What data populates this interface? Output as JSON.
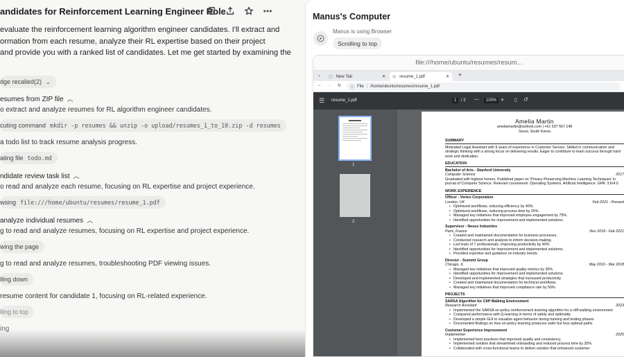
{
  "task": {
    "title": "andidates for Reinforcement Learning Engineer Role"
  },
  "chat": {
    "intro": [
      "evaluate the reinforcement learning algorithm engineer candidates. I'll extract and",
      "ormation from each resume, analyze their RL expertise based on their project",
      "and provide you with a ranked list of candidates. Let me get started by examining the"
    ],
    "knowledge_pill": "dge recalled(2)",
    "sections": [
      {
        "title": "esumes from ZIP file",
        "desc": "o extract and analyze resumes for RL algorithm engineer candidates."
      },
      {
        "title": "ndidate review task list",
        "desc": "o read and analyze each resume, focusing on RL expertise and project experience."
      },
      {
        "title": " analyze individual resumes",
        "desc": "g to read and analyze resumes, focusing on RL expertise and project experience."
      }
    ],
    "step1": {
      "label": "cuting command",
      "code": "mkdir -p resumes && unzip -o upload/resumes_1_to_10.zip -d resumes"
    },
    "step1_note": "a todo list to track resume analysis progress.",
    "step2": {
      "label": "ating file",
      "code": "todo.md"
    },
    "step3": {
      "label": "wsing",
      "code": "file:///home/ubuntu/resumes/resume_1.pdf"
    },
    "step4": "wing the page",
    "step4_note": "g to read and analyze resumes, troubleshooting PDF viewing issues.",
    "step5": "lling down",
    "step5_note": "resume content for candidate 1, focusing on RL-related experience.",
    "step6": "lling to top",
    "step7": "ing"
  },
  "computer": {
    "title": "Manus's Computer",
    "status_line": "Manus is using Browser",
    "status_chip": "Scrolling to top",
    "viewer_url": "file:///home/ubuntu/resumes/resum...",
    "tabs": [
      "New Tab",
      "resume_1.pdf"
    ],
    "address_label": "File",
    "address": "/home/ubuntu/resumes/resume_1.pdf",
    "pdf_name": "resume_1.pdf",
    "page_current": "1",
    "page_total": "/ 2",
    "zoom": "100%",
    "thumbs": [
      "1",
      "2"
    ]
  },
  "resume": {
    "name": "Amelia Martin",
    "contact": "ameliamartin@outlook.com | +61 537 567 148",
    "location": "Seoul, South Korea",
    "summary_h": "SUMMARY",
    "summary": "Motivated Legal Assistant with 9 years of experience in Customer Service. Skilled in communication and strategic thinking with a strong focus on delivering results. Eager to contribute to team success through hard work and dedication.",
    "education_h": "EDUCATION",
    "edu_degree": "Bachelor of Arts - Stanford University",
    "edu_field": "Computer Science",
    "edu_year": "2017",
    "edu_desc": "Graduated with highest honors. Published paper on 'Privacy-Preserving Machine Learning Techniques' in journal of Computer Science. Relevant coursework: Operating Systems, Artificial Intelligence. GPA: 3.6/4.0.",
    "work_h": "WORK EXPERIENCE",
    "jobs": [
      {
        "title": "Officer - Vertex Corporation",
        "loc": "London, UK",
        "dates": "Feb 2021 - Present",
        "bullets": [
          "Optimized workflows, reducing efficiency by 40%.",
          "Optimized workflows, reducing process time by 25%.",
          "Managed key initiatives that improved employee engagement by 75%.",
          "Identified opportunities for improvement and implemented solutions."
        ]
      },
      {
        "title": "Supervisor - Nexus Industries",
        "loc": "Paris, France",
        "dates": "Nov 2018 - Feb 2021",
        "bullets": [
          "Created and maintained documentation for business processes.",
          "Conducted research and analysis to inform decision-making.",
          "Led team of 7 professionals, improving productivity by 40%.",
          "Identified opportunities for improvement and implemented solutions.",
          "Provided expertise and guidance on industry trends."
        ]
      },
      {
        "title": "Director - Summit Group",
        "loc": "Chicago, IL",
        "dates": "May 2016 - Mar 2018",
        "bullets": [
          "Managed key initiatives that improved quality metrics by 30%.",
          "Identified opportunities for improvement and implemented solutions.",
          "Developed and implemented strategies that increased productivity.",
          "Created and maintained documentation for technical workflows.",
          "Managed key initiatives that improved compliance rate by 50%."
        ]
      }
    ],
    "projects_h": "PROJECTS",
    "projects": [
      {
        "title": "SARSA Algorithm for Cliff Walking Environment",
        "role": "Research Assistant",
        "year": "2023",
        "bullets": [
          "Implemented the SARSA on-policy reinforcement learning algorithm for a cliff walking environment",
          "Compared performance with Q-learning in terms of safety and optimality",
          "Developed a simple GUI to visualize agent behavior during training and testing phases",
          "Documented findings on how on-policy learning produces safer but less optimal paths"
        ]
      },
      {
        "title": "Customer Experience Improvement",
        "role": "Implementer",
        "year": "2025",
        "bullets": [
          "Implemented best practices that improved quality and consistency.",
          "Implemented solution that streamlined onboarding and reduced process time by 25%.",
          "Collaborated with cross-functional teams to deliver solution that enhanced customer"
        ]
      }
    ]
  }
}
